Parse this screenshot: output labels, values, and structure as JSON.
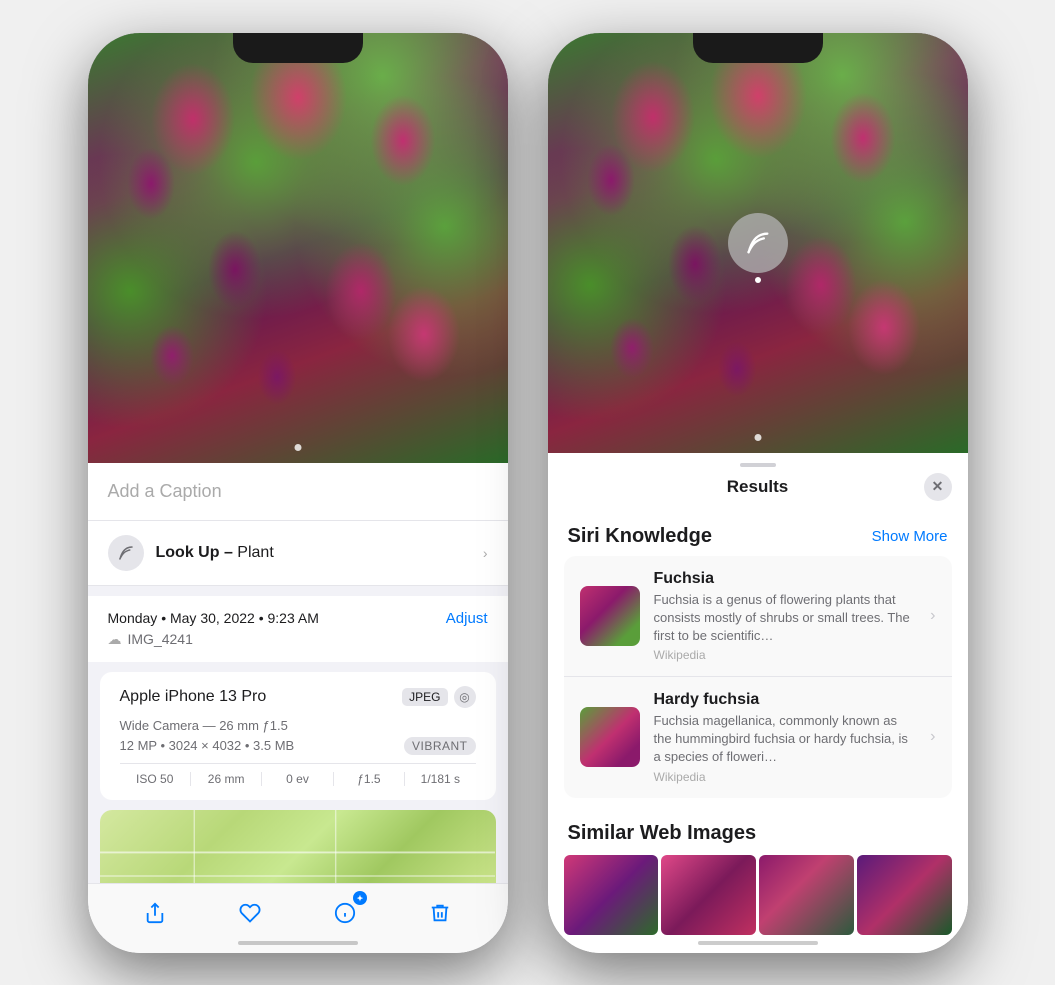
{
  "left_phone": {
    "caption_placeholder": "Add a Caption",
    "lookup": {
      "label": "Look Up –",
      "subject": "Plant",
      "chevron": "›"
    },
    "metadata": {
      "date": "Monday • May 30, 2022 • 9:23 AM",
      "adjust_label": "Adjust",
      "filename": "IMG_4241"
    },
    "device": {
      "name": "Apple iPhone 13 Pro",
      "format_badge": "JPEG",
      "camera": "Wide Camera — 26 mm ƒ1.5",
      "resolution": "12 MP • 3024 × 4032 • 3.5 MB",
      "style_badge": "VIBRANT",
      "exif": [
        {
          "label": "ISO 50"
        },
        {
          "label": "26 mm"
        },
        {
          "label": "0 ev"
        },
        {
          "label": "ƒ1.5"
        },
        {
          "label": "1/181 s"
        }
      ]
    },
    "toolbar": {
      "share": "⬆",
      "heart": "♡",
      "info": "ℹ",
      "trash": "🗑"
    }
  },
  "right_phone": {
    "sheet": {
      "title": "Results",
      "close_label": "✕"
    },
    "siri_knowledge": {
      "section_title": "Siri Knowledge",
      "show_more_label": "Show More",
      "items": [
        {
          "name": "Fuchsia",
          "description": "Fuchsia is a genus of flowering plants that consists mostly of shrubs or small trees. The first to be scientific…",
          "source": "Wikipedia"
        },
        {
          "name": "Hardy fuchsia",
          "description": "Fuchsia magellanica, commonly known as the hummingbird fuchsia or hardy fuchsia, is a species of floweri…",
          "source": "Wikipedia"
        }
      ]
    },
    "similar_section": {
      "title": "Similar Web Images"
    }
  }
}
